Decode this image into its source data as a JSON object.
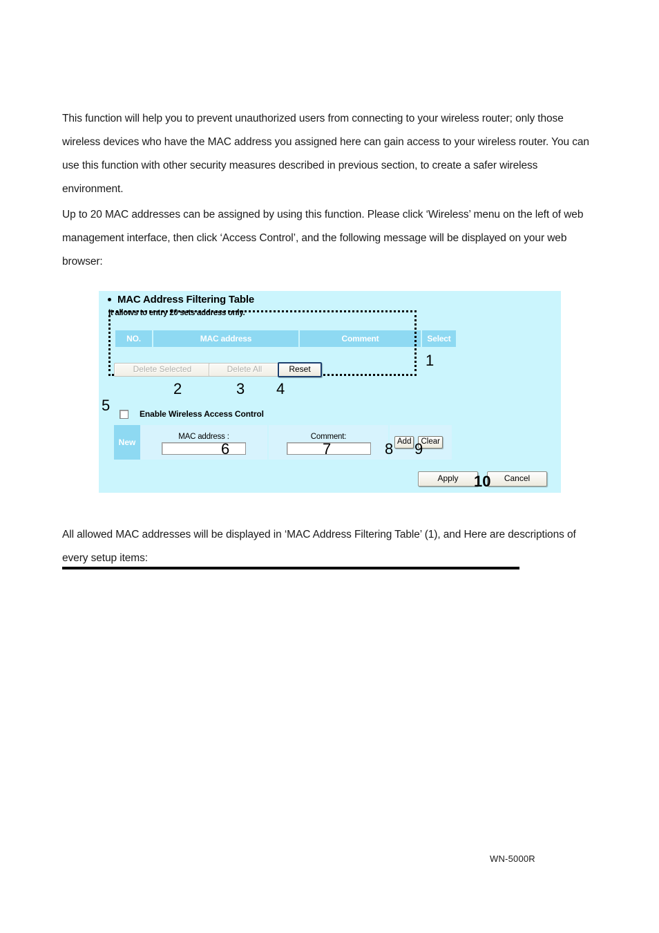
{
  "document": {
    "paragraphs": [
      "This function will help you to prevent unauthorized users from connecting to your wireless router; only those wireless devices who have the MAC address you assigned here can gain access to your wireless router. You can use this function with other security measures described in previous section, to create a safer wireless environment.",
      "Up to 20 MAC addresses can be assigned by using this function. Please click ‘Wireless’ menu on the left of web management interface, then click ‘Access Control’, and the following message will be displayed on your web browser:",
      "All allowed MAC addresses will be displayed in ‘MAC Address Filtering Table’ (1), and Here are descriptions of every setup items:"
    ],
    "footer": "WN-5000R"
  },
  "ui_panel": {
    "title": "MAC Address Filtering Table",
    "note": "It allows to entry 20 sets address only.",
    "table": {
      "columns": [
        "NO.",
        "MAC address",
        "Comment",
        "Select"
      ],
      "rows": []
    },
    "buttons": {
      "delete_selected": "Delete Selected",
      "delete_all": "Delete All",
      "reset": "Reset",
      "add": "Add",
      "clear": "Clear",
      "apply": "Apply",
      "cancel": "Cancel"
    },
    "enable_checkbox": {
      "label": "Enable Wireless Access Control",
      "checked": false
    },
    "new_entry": {
      "row_label": "New",
      "mac_label": "MAC address :",
      "mac_value": "",
      "mac_placeholder": "",
      "comment_label": "Comment:",
      "comment_value": "",
      "comment_placeholder": ""
    },
    "callouts": {
      "c1": "1",
      "c2": "2",
      "c3": "3",
      "c4": "4",
      "c5": "5",
      "c6": "6",
      "c7": "7",
      "c8": "8",
      "c9": "9",
      "c10": "10"
    },
    "colors": {
      "panel_background": "#cbf5fd",
      "table_header": "#8ed9f2",
      "row_background": "#d7f3fd",
      "header_text": "#ffffff"
    }
  }
}
